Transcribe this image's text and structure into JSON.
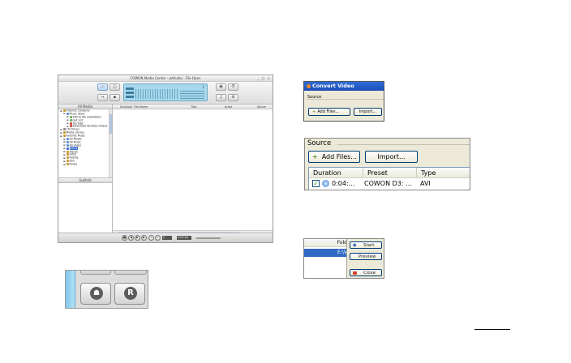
{
  "app_window": {
    "title": "COWON Media Center - jetAudio - File Open",
    "window_buttons": "_ □ ×",
    "lcd_number": "1",
    "nav_header": "All Media",
    "tree": [
      {
        "label": "Internet Contents",
        "color": "#c89a2a",
        "indent": 0
      },
      {
        "label": "Music Store",
        "color": "#5f8fd6",
        "indent": 1
      },
      {
        "label": "Add to My Subfolders",
        "color": "#6cae5a",
        "indent": 2
      },
      {
        "label": "Get List",
        "color": "#6cae5a",
        "indent": 2
      },
      {
        "label": "YouTube",
        "color": "#d44a3a",
        "indent": 2
      },
      {
        "label": "Download YouTube Videos",
        "color": "#d44a3a",
        "indent": 2
      },
      {
        "label": "CD Drives",
        "color": "#8a8a8a",
        "indent": 0
      },
      {
        "label": "Media Library",
        "color": "#c89a2a",
        "indent": 0
      },
      {
        "label": "Favorite Music",
        "color": "#c89a2a",
        "indent": 0
      },
      {
        "label": "All Media",
        "color": "#5f8fd6",
        "indent": 1
      },
      {
        "label": "All Music",
        "color": "#5f8fd6",
        "indent": 1
      },
      {
        "label": "All Video",
        "color": "#5f8fd6",
        "indent": 1
      },
      {
        "label": "Genre",
        "color": "#3366cc",
        "indent": 1,
        "selected": true
      },
      {
        "label": "Album",
        "color": "#c89a2a",
        "indent": 1
      },
      {
        "label": "Artist",
        "color": "#c89a2a",
        "indent": 1
      },
      {
        "label": "Rating",
        "color": "#c89a2a",
        "indent": 1
      },
      {
        "label": "Dirs",
        "color": "#c89a2a",
        "indent": 1
      },
      {
        "label": "Drops",
        "color": "#c89a2a",
        "indent": 1
      }
    ],
    "sub_header": "Subfold",
    "columns": [
      "Duration",
      "File Name",
      "Title",
      "Artist",
      "Album"
    ],
    "time_left": "0",
    "time_right": "0:00:00"
  },
  "convert_small": {
    "title": "Convert Video",
    "source_label": "Source",
    "add_files": "Add Files...",
    "import": "Import..."
  },
  "convert_large": {
    "source_label": "Source",
    "add_files": "Add Files...",
    "import": "Import...",
    "columns": [
      "Duration",
      "Preset",
      "Type"
    ],
    "row": {
      "checked": true,
      "duration": "0:04:...",
      "preset": "COWON D3: ...",
      "type": "AVI"
    }
  },
  "context_menu": {
    "column_header": "Fold",
    "selected_row": "E:\\V",
    "items": [
      "Start",
      "Preview",
      "Close"
    ]
  }
}
